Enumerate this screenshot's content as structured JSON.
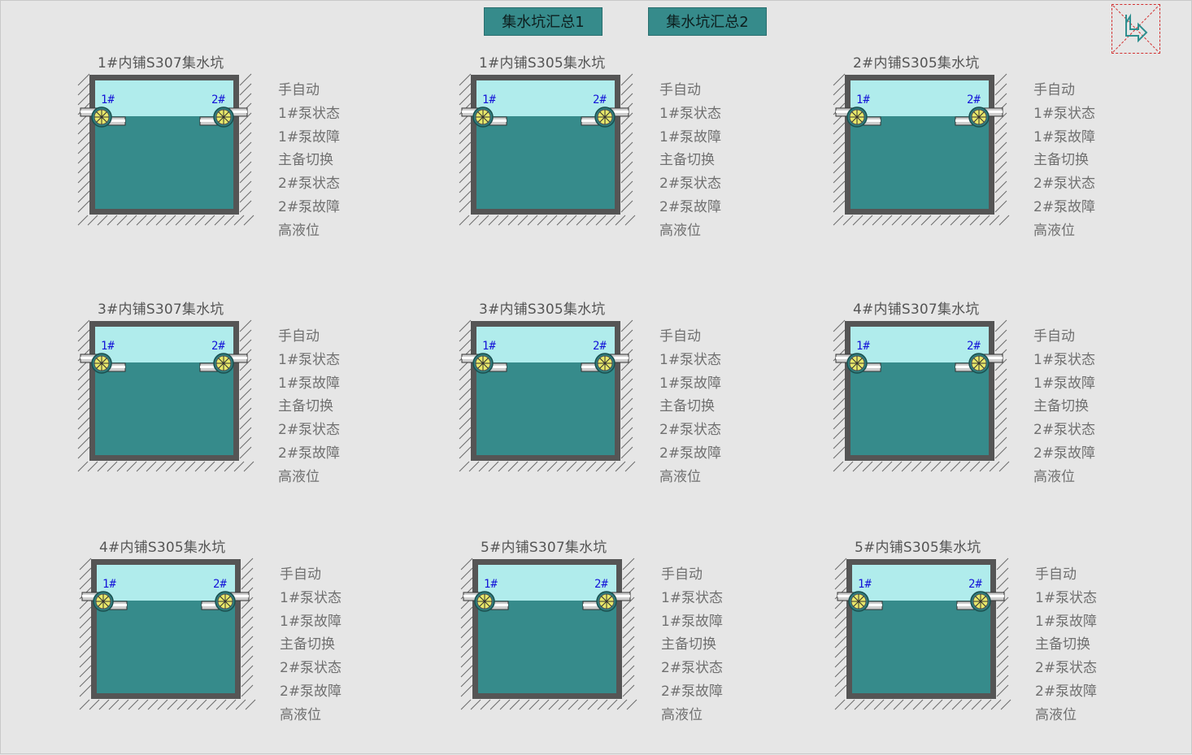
{
  "header": {
    "summary_button_1": "集水坑汇总1",
    "summary_button_2": "集水坑汇总2",
    "nav_icon": "navigate-arrow-icon"
  },
  "pits": [
    {
      "title": "1#内铺S307集水坑",
      "pump1_label": "1#",
      "pump2_label": "2#",
      "status_items": [
        "手自动",
        "1#泵状态",
        "1#泵故障",
        "主备切换",
        "2#泵状态",
        "2#泵故障",
        "高液位"
      ]
    },
    {
      "title": "1#内铺S305集水坑",
      "pump1_label": "1#",
      "pump2_label": "2#",
      "status_items": [
        "手自动",
        "1#泵状态",
        "1#泵故障",
        "主备切换",
        "2#泵状态",
        "2#泵故障",
        "高液位"
      ]
    },
    {
      "title": "2#内铺S305集水坑",
      "pump1_label": "1#",
      "pump2_label": "2#",
      "status_items": [
        "手自动",
        "1#泵状态",
        "1#泵故障",
        "主备切换",
        "2#泵状态",
        "2#泵故障",
        "高液位"
      ]
    },
    {
      "title": "3#内铺S307集水坑",
      "pump1_label": "1#",
      "pump2_label": "2#",
      "status_items": [
        "手自动",
        "1#泵状态",
        "1#泵故障",
        "主备切换",
        "2#泵状态",
        "2#泵故障",
        "高液位"
      ]
    },
    {
      "title": "3#内铺S305集水坑",
      "pump1_label": "1#",
      "pump2_label": "2#",
      "status_items": [
        "手自动",
        "1#泵状态",
        "1#泵故障",
        "主备切换",
        "2#泵状态",
        "2#泵故障",
        "高液位"
      ]
    },
    {
      "title": "4#内铺S307集水坑",
      "pump1_label": "1#",
      "pump2_label": "2#",
      "status_items": [
        "手自动",
        "1#泵状态",
        "1#泵故障",
        "主备切换",
        "2#泵状态",
        "2#泵故障",
        "高液位"
      ]
    },
    {
      "title": "4#内铺S305集水坑",
      "pump1_label": "1#",
      "pump2_label": "2#",
      "status_items": [
        "手自动",
        "1#泵状态",
        "1#泵故障",
        "主备切换",
        "2#泵状态",
        "2#泵故障",
        "高液位"
      ]
    },
    {
      "title": "5#内铺S307集水坑",
      "pump1_label": "1#",
      "pump2_label": "2#",
      "status_items": [
        "手自动",
        "1#泵状态",
        "1#泵故障",
        "主备切换",
        "2#泵状态",
        "2#泵故障",
        "高液位"
      ]
    },
    {
      "title": "5#内铺S305集水坑",
      "pump1_label": "1#",
      "pump2_label": "2#",
      "status_items": [
        "手自动",
        "1#泵状态",
        "1#泵故障",
        "主备切换",
        "2#泵状态",
        "2#泵故障",
        "高液位"
      ]
    }
  ],
  "colors": {
    "water": "#368b8b",
    "air_gap": "#b0ecec",
    "tank_wall": "#555555",
    "button_bg": "#368b8b",
    "pump_label": "#1414d8",
    "status_text": "#707070"
  }
}
